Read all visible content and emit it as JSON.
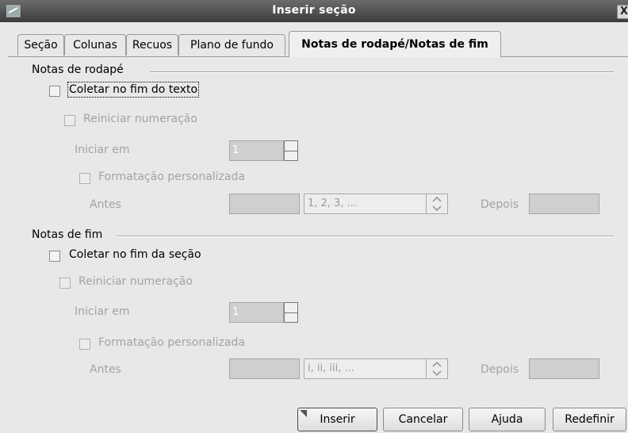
{
  "window": {
    "title": "Inserir seção",
    "close_glyph": "X",
    "icon": "app-icon"
  },
  "tabs": [
    {
      "label": "Seção"
    },
    {
      "label": "Colunas"
    },
    {
      "label": "Recuos"
    },
    {
      "label": "Plano de fundo"
    },
    {
      "label": "Notas de rodapé/Notas de fim",
      "active": true
    }
  ],
  "footnotes": {
    "heading": "Notas de rodapé",
    "collect": {
      "label": "Coletar no fim do texto",
      "checked": false
    },
    "restart": {
      "label": "Reiniciar numeração",
      "checked": false,
      "disabled": true
    },
    "start_at": {
      "label": "Iniciar em",
      "value": "1"
    },
    "custom_format": {
      "label": "Formatação personalizada",
      "checked": false
    },
    "before": {
      "label": "Antes",
      "value": ""
    },
    "numbering": {
      "value": "1, 2, 3, ..."
    },
    "after": {
      "label": "Depois",
      "value": ""
    }
  },
  "endnotes": {
    "heading": "Notas de fim",
    "collect": {
      "label": "Coletar no fim da seção",
      "checked": false
    },
    "restart": {
      "label": "Reiniciar numeração",
      "checked": false,
      "disabled": true
    },
    "start_at": {
      "label": "Iniciar em",
      "value": "1"
    },
    "custom_format": {
      "label": "Formatação personalizada",
      "checked": false
    },
    "before": {
      "label": "Antes",
      "value": ""
    },
    "numbering": {
      "value": "i, ii, iii, ..."
    },
    "after": {
      "label": "Depois",
      "value": ""
    }
  },
  "buttons": {
    "insert": "Inserir",
    "cancel": "Cancelar",
    "help": "Ajuda",
    "reset": "Redefinir"
  },
  "colors": {
    "titlebar": "#4a4a4a",
    "background": "#e8e8e8",
    "disabled_text": "#a3a3a3"
  }
}
